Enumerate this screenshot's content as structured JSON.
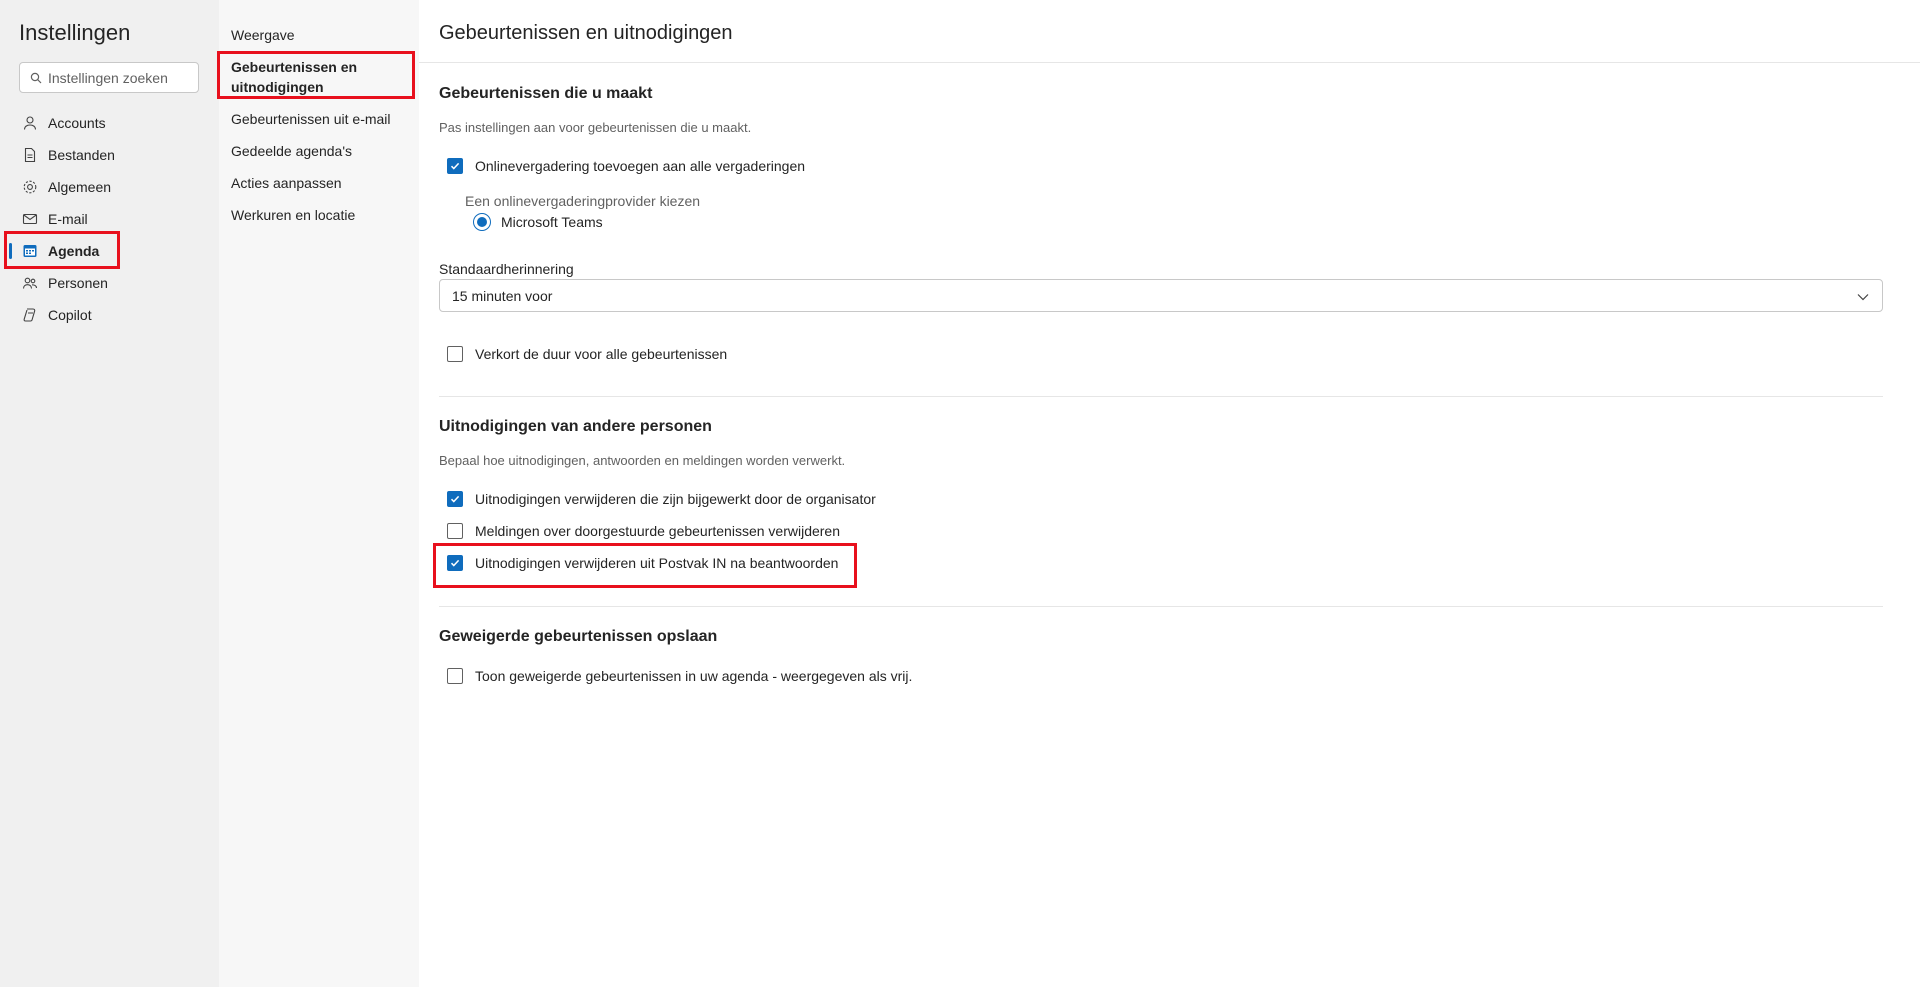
{
  "app_title": "Instellingen",
  "search": {
    "placeholder": "Instellingen zoeken"
  },
  "nav": {
    "items": [
      {
        "label": "Accounts",
        "icon": "person-icon"
      },
      {
        "label": "Bestanden",
        "icon": "document-icon"
      },
      {
        "label": "Algemeen",
        "icon": "gear-icon"
      },
      {
        "label": "E-mail",
        "icon": "mail-icon"
      },
      {
        "label": "Agenda",
        "icon": "calendar-icon",
        "active": true
      },
      {
        "label": "Personen",
        "icon": "people-icon"
      },
      {
        "label": "Copilot",
        "icon": "copilot-icon"
      }
    ]
  },
  "subnav": {
    "items": [
      {
        "label": "Weergave"
      },
      {
        "label": "Gebeurtenissen en uitnodigingen",
        "active": true
      },
      {
        "label": "Gebeurtenissen uit e-mail"
      },
      {
        "label": "Gedeelde agenda's"
      },
      {
        "label": "Acties aanpassen"
      },
      {
        "label": "Werkuren en locatie"
      }
    ]
  },
  "main": {
    "title": "Gebeurtenissen en uitnodigingen",
    "section1": {
      "heading": "Gebeurtenissen die u maakt",
      "description": "Pas instellingen aan voor gebeurtenissen die u maakt.",
      "online_meeting": {
        "label": "Onlinevergadering toevoegen aan alle vergaderingen",
        "checked": true
      },
      "provider_label": "Een onlinevergaderingprovider kiezen",
      "provider_option": {
        "label": "Microsoft Teams",
        "selected": true
      },
      "reminder_label": "Standaardherinnering",
      "reminder_value": "15 minuten voor",
      "shorten": {
        "label": "Verkort de duur voor alle gebeurtenissen",
        "checked": false
      }
    },
    "section2": {
      "heading": "Uitnodigingen van andere personen",
      "description": "Bepaal hoe uitnodigingen, antwoorden en meldingen worden verwerkt.",
      "opt1": {
        "label": "Uitnodigingen verwijderen die zijn bijgewerkt door de organisator",
        "checked": true
      },
      "opt2": {
        "label": "Meldingen over doorgestuurde gebeurtenissen verwijderen",
        "checked": false
      },
      "opt3": {
        "label": "Uitnodigingen verwijderen uit Postvak IN na beantwoorden",
        "checked": true
      }
    },
    "section3": {
      "heading": "Geweigerde gebeurtenissen opslaan",
      "opt1": {
        "label": "Toon geweigerde gebeurtenissen in uw agenda - weergegeven als vrij.",
        "checked": false
      }
    }
  },
  "colors": {
    "accent": "#0f6cbd",
    "highlight": "#e8101d"
  }
}
